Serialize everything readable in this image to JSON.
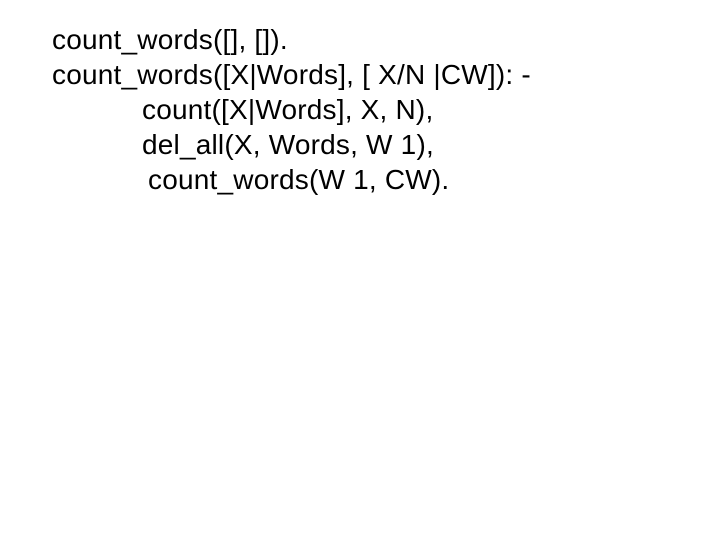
{
  "code": {
    "line1": "count_words([], []).",
    "line2": "count_words([X|Words], [ X/N |CW]): -",
    "line3": "count([X|Words], X, N),",
    "line4": "del_all(X, Words, W 1),",
    "line5": "count_words(W 1, CW)."
  }
}
